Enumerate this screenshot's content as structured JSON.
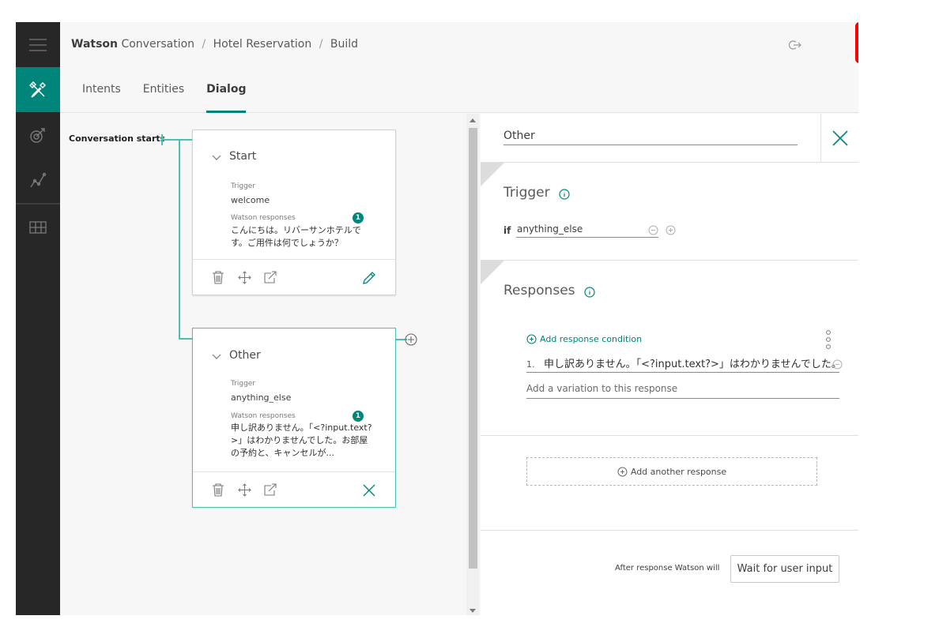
{
  "breadcrumb": {
    "brand": "Watson",
    "product": "Conversation",
    "workspace": "Hotel Reservation",
    "page": "Build"
  },
  "tabs": [
    {
      "label": "Intents",
      "active": false
    },
    {
      "label": "Entities",
      "active": false
    },
    {
      "label": "Dialog",
      "active": true
    }
  ],
  "tree": {
    "root_label": "Conversation starts",
    "nodes": [
      {
        "title": "Start",
        "trigger_label": "Trigger",
        "trigger": "welcome",
        "responses_label": "Watson responses",
        "response_count": "1",
        "response_line1": "こんにちは。リバーサンホテルで",
        "response_line2": "す。ご用件は何でしょうか？"
      },
      {
        "title": "Other",
        "trigger_label": "Trigger",
        "trigger": "anything_else",
        "responses_label": "Watson responses",
        "response_count": "1",
        "response_line1": "申し訳ありません。「<?input.text?",
        "response_line2": ">」はわかりませんでした。お部屋",
        "response_line3": "の予約と、キャンセルが..."
      }
    ]
  },
  "panel": {
    "node_name": "Other",
    "trigger_title": "Trigger",
    "if_label": "if",
    "condition": "anything_else",
    "responses_title": "Responses",
    "add_condition": "Add response condition",
    "response_number": "1.",
    "response_text": "申し訳ありません。「<?input.text?>」はわかりませんでした。",
    "variation_placeholder": "Add a variation to this response",
    "add_another": "Add another response",
    "after_label": "After response Watson will",
    "wait_button": "Wait for user input"
  },
  "colors": {
    "accent": "#00857a",
    "tree_line": "#4bc2b0",
    "highlight_box": "#ff0000"
  },
  "icons": [
    "menu-icon",
    "tools-icon",
    "target-icon",
    "analytics-icon",
    "dashboard-icon",
    "logout-icon",
    "chat-icon",
    "chevron-down-icon",
    "trash-icon",
    "move-icon",
    "jump-icon",
    "edit-icon",
    "close-icon",
    "info-icon",
    "add-icon",
    "remove-icon",
    "kebab-icon"
  ]
}
